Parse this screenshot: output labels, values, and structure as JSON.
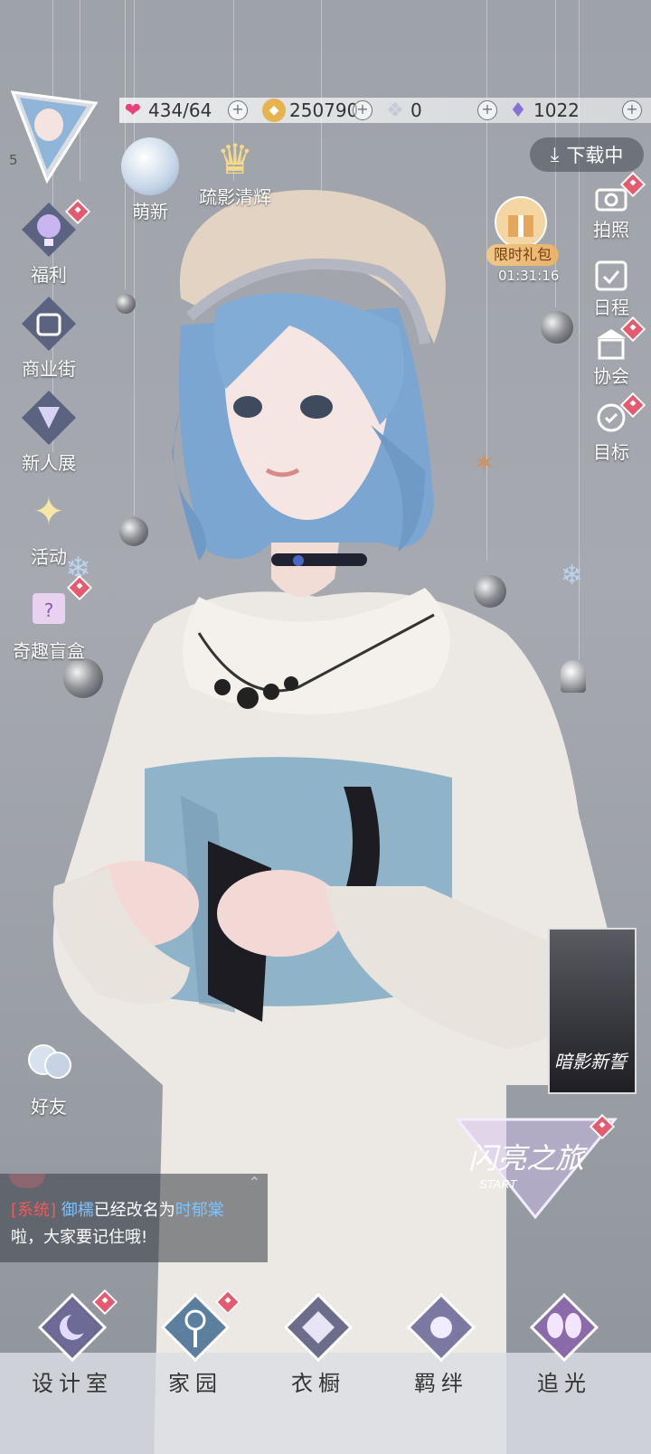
{
  "resources": {
    "stamina": {
      "icon": "heart-gem-icon",
      "value": "434/64"
    },
    "gold": {
      "icon": "gold-coin-icon",
      "value": "250790"
    },
    "crystal": {
      "icon": "crystal-icon",
      "value": "0"
    },
    "diamond": {
      "icon": "diamond-icon",
      "value": "1022"
    }
  },
  "player": {
    "level": "5"
  },
  "download": {
    "label": "下载中"
  },
  "top_icons": {
    "mengxin": "萌新",
    "shuying": "疏影清辉"
  },
  "left_menu": [
    {
      "label": "福利",
      "icon": "hot-air-balloon-icon",
      "badge": true
    },
    {
      "label": "商业街",
      "icon": "shopping-bag-icon",
      "badge": false
    },
    {
      "label": "新人展",
      "icon": "crown-trophy-icon",
      "badge": false
    },
    {
      "label": "活动",
      "icon": "stars-icon",
      "badge": false
    },
    {
      "label": "奇趣盲盒",
      "icon": "mystery-box-icon",
      "badge": true
    },
    {
      "label": "好友",
      "icon": "friends-icon",
      "badge": false
    }
  ],
  "right_menu": [
    {
      "label": "拍照",
      "icon": "camera-icon",
      "badge": true
    },
    {
      "label": "日程",
      "icon": "calendar-icon",
      "badge": false
    },
    {
      "label": "协会",
      "icon": "guild-building-icon",
      "badge": true
    },
    {
      "label": "目标",
      "icon": "target-medal-icon",
      "badge": true
    }
  ],
  "gift": {
    "label": "限时礼包",
    "timer": "01:31:16"
  },
  "promo": {
    "title": "暗影新誓"
  },
  "journey": {
    "title": "闪亮之旅",
    "sub": "START"
  },
  "chat": {
    "tag": "[系统]",
    "name1": "御檽",
    "mid": "已经改名为",
    "name2": "时郁棠",
    "line2": "啦，大家要记住哦!"
  },
  "bottom_nav": [
    {
      "label": "设计室",
      "icon": "moon-design-icon",
      "badge": true
    },
    {
      "label": "家园",
      "icon": "key-home-icon",
      "badge": true
    },
    {
      "label": "衣橱",
      "icon": "wardrobe-gem-icon",
      "badge": false
    },
    {
      "label": "羁绊",
      "icon": "flower-bond-icon",
      "badge": false
    },
    {
      "label": "追光",
      "icon": "butterfly-icon",
      "badge": false
    }
  ],
  "colors": {
    "badge": "#e45a6f",
    "accent_blue": "#7bc4ff",
    "system_red": "#ef5a5a"
  }
}
